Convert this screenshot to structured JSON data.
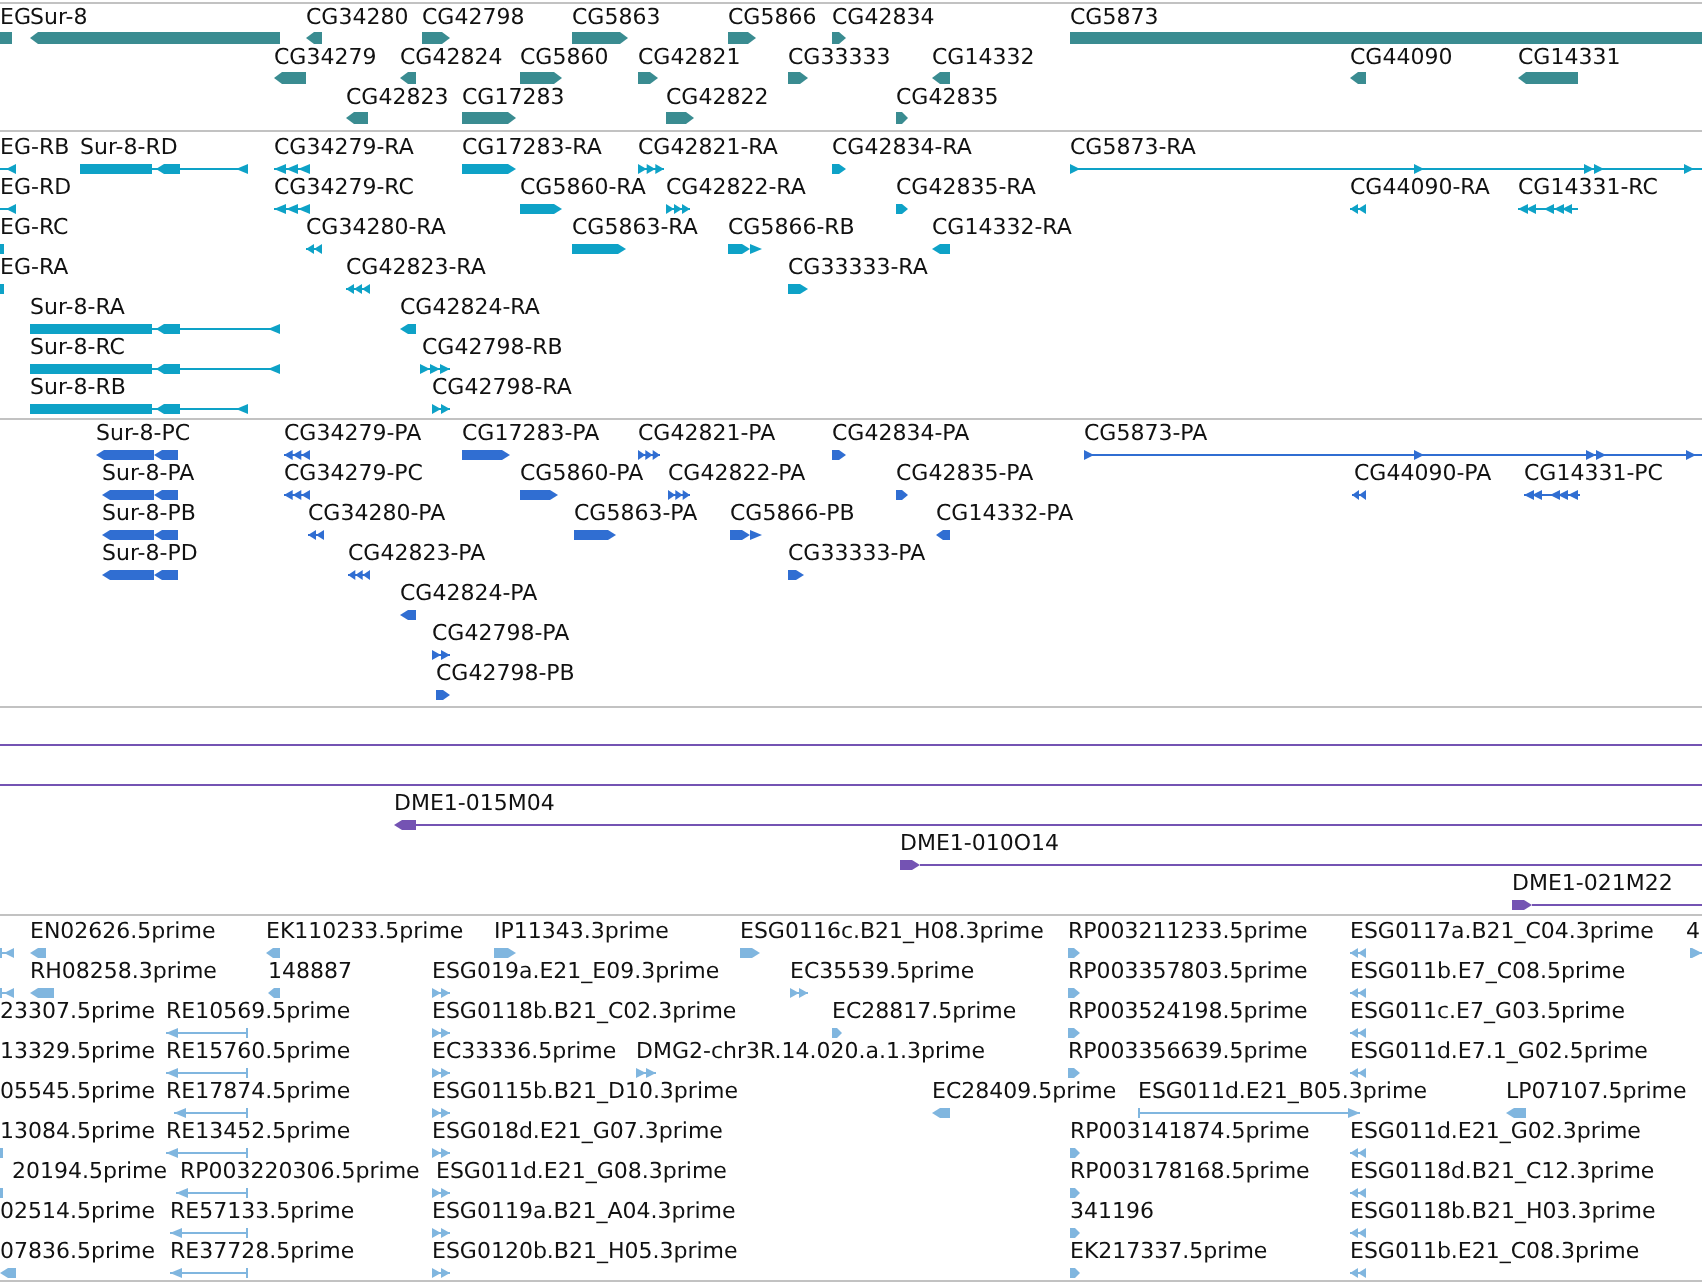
{
  "tracks": [
    {
      "kind": "gene",
      "rows": [
        {
          "features": [
            {
              "label": "EG"
            },
            {
              "label": "Sur-8",
              "reverse": true
            },
            {
              "label": "CG34280",
              "reverse": true
            },
            {
              "label": "CG42798",
              "reverse": false
            },
            {
              "label": "CG5863",
              "reverse": false
            },
            {
              "label": "CG5866",
              "reverse": false
            },
            {
              "label": "CG42834",
              "reverse": false
            },
            {
              "label": "CG5873"
            }
          ]
        },
        {
          "features": [
            {
              "label": "CG34279",
              "reverse": true
            },
            {
              "label": "CG42824",
              "reverse": true
            },
            {
              "label": "CG5860",
              "reverse": false
            },
            {
              "label": "CG42821",
              "reverse": false
            },
            {
              "label": "CG33333",
              "reverse": false
            },
            {
              "label": "CG14332",
              "reverse": true
            },
            {
              "label": "CG44090",
              "reverse": true
            },
            {
              "label": "CG14331",
              "reverse": true
            }
          ]
        },
        {
          "features": [
            {
              "label": "CG42823",
              "reverse": true
            },
            {
              "label": "CG17283",
              "reverse": false
            },
            {
              "label": "CG42822",
              "reverse": false
            },
            {
              "label": "CG42835",
              "reverse": false
            }
          ]
        }
      ]
    },
    {
      "kind": "transcript",
      "rows": [
        {
          "features": [
            {
              "label": "EG-RB",
              "reverse": true
            },
            {
              "label": "Sur-8-RD",
              "reverse": true
            },
            {
              "label": "CG34279-RA",
              "reverse": true
            },
            {
              "label": "CG17283-RA",
              "reverse": false
            },
            {
              "label": "CG42821-RA",
              "reverse": false
            },
            {
              "label": "CG42834-RA",
              "reverse": false
            },
            {
              "label": "CG5873-RA",
              "reverse": false
            }
          ]
        },
        {
          "features": [
            {
              "label": "EG-RD",
              "reverse": true
            },
            {
              "label": "CG34279-RC",
              "reverse": true
            },
            {
              "label": "CG5860-RA",
              "reverse": false
            },
            {
              "label": "CG42822-RA",
              "reverse": false
            },
            {
              "label": "CG42835-RA",
              "reverse": false
            },
            {
              "label": "CG44090-RA",
              "reverse": true
            },
            {
              "label": "CG14331-RC",
              "reverse": true
            }
          ]
        },
        {
          "features": [
            {
              "label": "EG-RC"
            },
            {
              "label": "CG34280-RA",
              "reverse": true
            },
            {
              "label": "CG5863-RA",
              "reverse": false
            },
            {
              "label": "CG5866-RB",
              "reverse": false
            },
            {
              "label": "CG14332-RA",
              "reverse": true
            }
          ]
        },
        {
          "features": [
            {
              "label": "EG-RA"
            },
            {
              "label": "CG42823-RA",
              "reverse": true
            },
            {
              "label": "CG33333-RA",
              "reverse": false
            }
          ]
        },
        {
          "features": [
            {
              "label": "Sur-8-RA",
              "reverse": true
            },
            {
              "label": "CG42824-RA",
              "reverse": true
            }
          ]
        },
        {
          "features": [
            {
              "label": "Sur-8-RC",
              "reverse": true
            },
            {
              "label": "CG42798-RB",
              "reverse": false
            }
          ]
        },
        {
          "features": [
            {
              "label": "Sur-8-RB",
              "reverse": true
            },
            {
              "label": "CG42798-RA",
              "reverse": false
            }
          ]
        }
      ]
    },
    {
      "kind": "protein",
      "rows": [
        {
          "features": [
            {
              "label": "Sur-8-PC",
              "reverse": true
            },
            {
              "label": "CG34279-PA",
              "reverse": true
            },
            {
              "label": "CG17283-PA",
              "reverse": false
            },
            {
              "label": "CG42821-PA",
              "reverse": false
            },
            {
              "label": "CG42834-PA",
              "reverse": false
            },
            {
              "label": "CG5873-PA",
              "reverse": false
            }
          ]
        },
        {
          "features": [
            {
              "label": "Sur-8-PA",
              "reverse": true
            },
            {
              "label": "CG34279-PC",
              "reverse": true
            },
            {
              "label": "CG5860-PA",
              "reverse": false
            },
            {
              "label": "CG42822-PA",
              "reverse": false
            },
            {
              "label": "CG42835-PA",
              "reverse": false
            },
            {
              "label": "CG44090-PA",
              "reverse": true
            },
            {
              "label": "CG14331-PC",
              "reverse": true
            }
          ]
        },
        {
          "features": [
            {
              "label": "Sur-8-PB",
              "reverse": true
            },
            {
              "label": "CG34280-PA",
              "reverse": true
            },
            {
              "label": "CG5863-PA",
              "reverse": false
            },
            {
              "label": "CG5866-PB",
              "reverse": false
            },
            {
              "label": "CG14332-PA",
              "reverse": true
            }
          ]
        },
        {
          "features": [
            {
              "label": "Sur-8-PD",
              "reverse": true
            },
            {
              "label": "CG42823-PA",
              "reverse": true
            },
            {
              "label": "CG33333-PA",
              "reverse": false
            }
          ]
        },
        {
          "features": [
            {
              "label": "CG42824-PA",
              "reverse": true
            }
          ]
        },
        {
          "features": [
            {
              "label": "CG42798-PA",
              "reverse": false
            }
          ]
        },
        {
          "features": [
            {
              "label": "CG42798-PB",
              "reverse": false
            }
          ]
        }
      ]
    },
    {
      "kind": "clone",
      "rows": [
        {
          "features": [
            {
              "kind": "span"
            }
          ]
        },
        {
          "features": [
            {
              "kind": "span"
            }
          ]
        },
        {
          "features": [
            {
              "kind": "clone",
              "label": "DME1-015M04",
              "reverse": true
            }
          ]
        },
        {
          "features": [
            {
              "kind": "clone",
              "label": "DME1-010O14",
              "reverse": false
            }
          ]
        },
        {
          "features": [
            {
              "kind": "clone",
              "label": "DME1-021M22",
              "reverse": false
            }
          ]
        }
      ]
    },
    {
      "kind": "est",
      "rows": [
        {
          "features": [
            {
              "reverse": true
            },
            {
              "label": "EN02626.5prime",
              "reverse": true
            },
            {
              "label": "EK110233.5prime",
              "reverse": true
            },
            {
              "label": "IP11343.3prime",
              "reverse": false
            },
            {
              "label": "ESG0116c.B21_H08.3prime",
              "reverse": false
            },
            {
              "label": "RP003211233.5prime",
              "reverse": false
            },
            {
              "label": "ESG0117a.B21_C04.3prime",
              "reverse": true
            },
            {
              "label": "4",
              "reverse": false
            }
          ]
        },
        {
          "features": [
            {
              "reverse": true
            },
            {
              "label": "RH08258.3prime",
              "reverse": true
            },
            {
              "label": "148887",
              "reverse": true
            },
            {
              "label": "ESG019a.E21_E09.3prime",
              "reverse": false
            },
            {
              "label": "EC35539.5prime",
              "reverse": false
            },
            {
              "label": "RP003357803.5prime",
              "reverse": false
            },
            {
              "label": "ESG011b.E7_C08.5prime",
              "reverse": true
            }
          ]
        },
        {
          "features": [
            {
              "label": "23307.5prime"
            },
            {
              "label": "RE10569.5prime",
              "reverse": true
            },
            {
              "label": "ESG0118b.B21_C02.3prime",
              "reverse": false
            },
            {
              "label": "EC28817.5prime",
              "reverse": false
            },
            {
              "label": "RP003524198.5prime",
              "reverse": false
            },
            {
              "label": "ESG011c.E7_G03.5prime",
              "reverse": true
            }
          ]
        },
        {
          "features": [
            {
              "label": "13329.5prime"
            },
            {
              "label": "RE15760.5prime",
              "reverse": true
            },
            {
              "label": "EC33336.5prime",
              "reverse": false
            },
            {
              "label": "DMG2-chr3R.14.020.a.1.3prime",
              "reverse": false
            },
            {
              "label": "RP003356639.5prime",
              "reverse": false
            },
            {
              "label": "ESG011d.E7.1_G02.5prime",
              "reverse": true
            }
          ]
        },
        {
          "features": [
            {
              "label": "05545.5prime"
            },
            {
              "label": "RE17874.5prime",
              "reverse": true
            },
            {
              "label": "ESG0115b.B21_D10.3prime",
              "reverse": false
            },
            {
              "label": "EC28409.5prime",
              "reverse": true
            },
            {
              "label": "ESG011d.E21_B05.3prime",
              "reverse": false
            },
            {
              "label": "LP07107.5prime",
              "reverse": true
            }
          ]
        },
        {
          "features": [
            {
              "label": "13084.5prime"
            },
            {
              "label": "RE13452.5prime",
              "reverse": true
            },
            {
              "label": "ESG018d.E21_G07.3prime",
              "reverse": false
            },
            {
              "label": "RP003141874.5prime",
              "reverse": false
            },
            {
              "label": "ESG011d.E21_G02.3prime",
              "reverse": true
            }
          ]
        },
        {
          "features": [
            {
              "label": "20194.5prime"
            },
            {
              "label": "RP003220306.5prime",
              "reverse": true
            },
            {
              "label": "ESG011d.E21_G08.3prime",
              "reverse": false
            },
            {
              "label": "RP003178168.5prime",
              "reverse": false
            },
            {
              "label": "ESG0118d.B21_C12.3prime",
              "reverse": true
            }
          ]
        },
        {
          "features": [
            {
              "label": "02514.5prime"
            },
            {
              "label": "RE57133.5prime",
              "reverse": true
            },
            {
              "label": "ESG0119a.B21_A04.3prime",
              "reverse": false
            },
            {
              "label": "341196",
              "reverse": false
            },
            {
              "label": "ESG0118b.B21_H03.3prime",
              "reverse": true
            }
          ]
        },
        {
          "features": [
            {
              "label": "07836.5prime",
              "reverse": true
            },
            {
              "label": "RE37728.5prime",
              "reverse": true
            },
            {
              "label": "ESG0120b.B21_H05.3prime",
              "reverse": false
            },
            {
              "label": "EK217337.5prime",
              "reverse": false
            },
            {
              "label": "ESG011b.E21_C08.3prime",
              "reverse": true
            }
          ]
        }
      ]
    }
  ]
}
